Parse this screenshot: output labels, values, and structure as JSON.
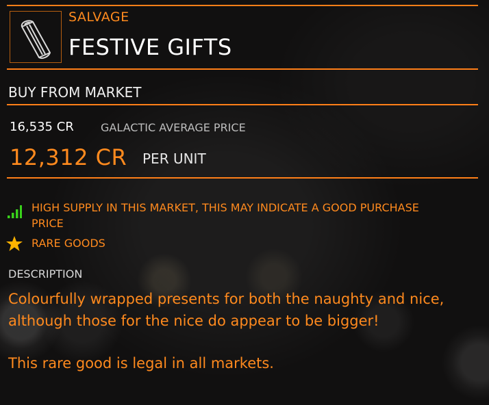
{
  "item": {
    "icon": "canister-icon",
    "category": "SALVAGE",
    "name": "FESTIVE GIFTS"
  },
  "market": {
    "heading": "BUY FROM MARKET",
    "galactic_average_price": "16,535 CR",
    "galactic_average_label": "GALACTIC AVERAGE PRICE",
    "unit_price": "12,312 CR",
    "unit_label": "PER UNIT"
  },
  "indicators": {
    "supply_icon": "signal-bars-icon",
    "supply_text": "HIGH SUPPLY IN THIS MARKET, THIS MAY INDICATE A GOOD PURCHASE PRICE",
    "rare_icon": "star-icon",
    "rare_text": "RARE GOODS"
  },
  "description": {
    "heading": "DESCRIPTION",
    "body": "Colourfully wrapped presents for both the naughty and nice, although those for the nice do appear to be bigger!",
    "legal": "This rare good is legal in all markets."
  },
  "colors": {
    "accent": "#ff7f18",
    "text_orange": "#ff8a1e",
    "supply_green": "#39d11b",
    "star_gold": "#ffb300",
    "background": "#111010"
  }
}
